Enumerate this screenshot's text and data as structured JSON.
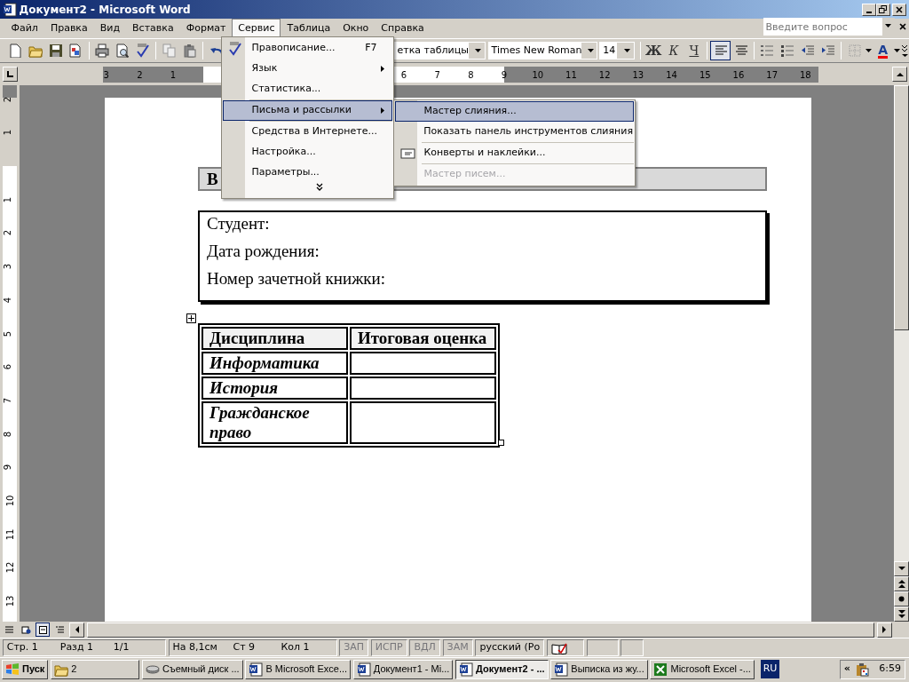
{
  "window": {
    "title": "Документ2 - Microsoft Word"
  },
  "menu_bar": [
    {
      "label": "Файл",
      "selected": false
    },
    {
      "label": "Правка",
      "selected": false
    },
    {
      "label": "Вид",
      "selected": false
    },
    {
      "label": "Вставка",
      "selected": false
    },
    {
      "label": "Формат",
      "selected": false
    },
    {
      "label": "Сервис",
      "selected": true
    },
    {
      "label": "Таблица",
      "selected": false
    },
    {
      "label": "Окно",
      "selected": false
    },
    {
      "label": "Справка",
      "selected": false
    }
  ],
  "help_box": {
    "placeholder": "Введите вопрос"
  },
  "toolbar": {
    "style": "етка таблицы",
    "font": "Times New Roman",
    "size": "14",
    "bold": "Ж",
    "italic": "К",
    "underline": "Ч",
    "font_color": "A",
    "align": [
      {
        "kind": "left",
        "selected": true
      },
      {
        "kind": "center",
        "selected": false
      }
    ]
  },
  "ruler": {
    "left_labels": [
      "3",
      "2",
      "1"
    ],
    "right_labels": [
      "6",
      "7",
      "8",
      "9",
      "10",
      "11",
      "12",
      "13",
      "14",
      "15",
      "16",
      "17",
      "18"
    ]
  },
  "vertical_ruler": {
    "top_labels": [
      "2",
      "1"
    ],
    "labels": [
      "1",
      "2",
      "3",
      "4",
      "5",
      "6",
      "7",
      "8",
      "9",
      "10",
      "11",
      "12",
      "13"
    ]
  },
  "document": {
    "heading": "В",
    "info": [
      "Студент:",
      "Дата рождения:",
      "Номер зачетной книжки:"
    ],
    "table": {
      "columns": [
        "Дисциплина",
        "Итоговая оценка"
      ],
      "rows": [
        {
          "subject": "Информатика"
        },
        {
          "subject": "История"
        },
        {
          "subject": "Гражданское право"
        }
      ]
    }
  },
  "tools_menu": {
    "items": [
      {
        "kind": "command",
        "label": "Правописание...",
        "shortcut": "F7",
        "selected": false
      },
      {
        "kind": "submenu",
        "label": "Язык",
        "selected": false
      },
      {
        "kind": "command",
        "label": "Статистика...",
        "selected": false
      },
      {
        "kind": "separator"
      },
      {
        "kind": "submenu",
        "label": "Письма и рассылки",
        "selected": true
      },
      {
        "kind": "separator"
      },
      {
        "kind": "command",
        "label": "Средства в Интернете...",
        "selected": false
      },
      {
        "kind": "command",
        "label": "Настройка...",
        "selected": false
      },
      {
        "kind": "command",
        "label": "Параметры...",
        "selected": false
      },
      {
        "kind": "expand"
      }
    ]
  },
  "submenu": {
    "items": [
      {
        "kind": "command",
        "label": "Мастер слияния...",
        "selected": true,
        "disabled": false
      },
      {
        "kind": "command",
        "label": "Показать панель инструментов слияния",
        "selected": false,
        "disabled": false
      },
      {
        "kind": "separator"
      },
      {
        "kind": "command",
        "label": "Конверты и наклейки...",
        "selected": false,
        "disabled": false
      },
      {
        "kind": "separator"
      },
      {
        "kind": "command",
        "label": "Мастер писем...",
        "selected": false,
        "disabled": true
      }
    ]
  },
  "view_buttons": [
    {
      "kind": "normal",
      "selected": false
    },
    {
      "kind": "web",
      "selected": false
    },
    {
      "kind": "print",
      "selected": true
    },
    {
      "kind": "outline",
      "selected": false
    }
  ],
  "status_bar": {
    "panes": [
      [
        "Стр. 1",
        "Разд 1",
        "1/1"
      ],
      [
        "На 8,1см",
        "Ст 9",
        "Кол 1"
      ]
    ],
    "flags": [
      {
        "text": "ЗАП",
        "disabled": true
      },
      {
        "text": "ИСПР",
        "disabled": true
      },
      {
        "text": "ВДЛ",
        "disabled": true
      },
      {
        "text": "ЗАМ",
        "disabled": true
      }
    ],
    "language": "русский (Ро"
  },
  "taskbar": {
    "start": "Пуск",
    "tasks": [
      {
        "kind": "folder",
        "label": "2",
        "selected": false
      },
      {
        "kind": "drive",
        "label": "Съемный диск ...",
        "selected": false
      },
      {
        "kind": "word",
        "label": "В Microsoft Exce...",
        "selected": false
      },
      {
        "kind": "word",
        "label": "Документ1 - Mi...",
        "selected": false
      },
      {
        "kind": "word",
        "label": "Документ2 - ...",
        "selected": true
      },
      {
        "kind": "word",
        "label": "Выписка из жу...",
        "selected": false
      },
      {
        "kind": "excel",
        "label": "Microsoft Excel -...",
        "selected": false
      }
    ],
    "language": "RU",
    "tray_expand": "«",
    "clock": "6:59"
  }
}
